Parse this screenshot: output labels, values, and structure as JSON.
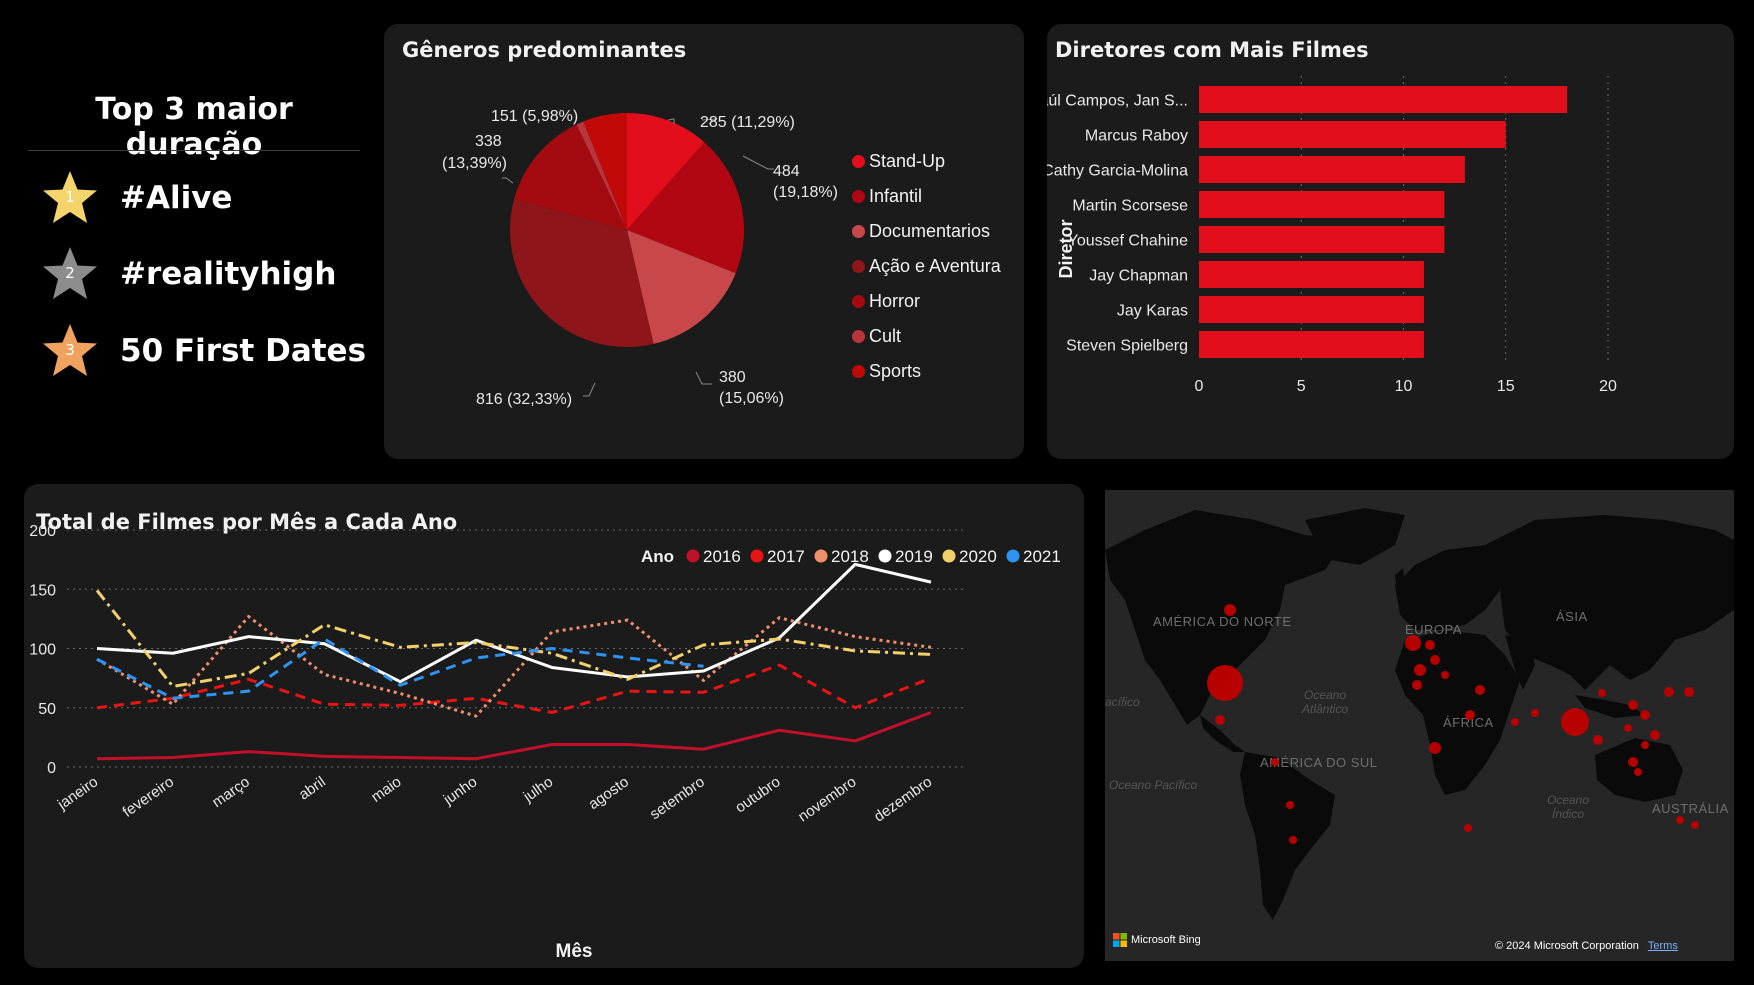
{
  "top3": {
    "title": "Top 3 maior duração",
    "items": [
      {
        "rank": "1",
        "name": "#Alive",
        "color": "#f5d56b"
      },
      {
        "rank": "2",
        "name": "#realityhigh",
        "color": "#8c8c8c"
      },
      {
        "rank": "3",
        "name": "50 First Dates",
        "color": "#f0a35e"
      }
    ]
  },
  "pie": {
    "title": "Gêneros predominantes",
    "slices": [
      {
        "name": "Stand-Up",
        "value": 285,
        "label": "285 (11,29%)",
        "color": "#e30e1b"
      },
      {
        "name": "Infantil",
        "value": 484,
        "label": "484 (19,18%)",
        "color": "#b00713"
      },
      {
        "name": "Documentarios",
        "value": 380,
        "label": "380 (15,06%)",
        "color": "#c8474b"
      },
      {
        "name": "Ação e Aventura",
        "value": 816,
        "label": "816 (32,33%)",
        "color": "#8e1519"
      },
      {
        "name": "Horror",
        "value": 338,
        "label": "338 (13,39%)",
        "color": "#a40b10"
      },
      {
        "name": "Cult",
        "value": 25,
        "label": "",
        "color": "#b8363b"
      },
      {
        "name": "Sports",
        "value": 151,
        "label": "151 (5,98%)",
        "color": "#c10909"
      }
    ],
    "label_parts": {
      "stand_up": "285 (11,29%)",
      "infantil_a": "484",
      "infantil_b": "(19,18%)",
      "doc_a": "380",
      "doc_b": "(15,06%)",
      "acao": "816 (32,33%)",
      "horror_a": "338",
      "horror_b": "(13,39%)",
      "sports": "151 (5,98%)"
    }
  },
  "directors": {
    "title": "Diretores com Mais Filmes",
    "axis_label": "Diretor",
    "ticks": [
      "0",
      "5",
      "10",
      "15",
      "20"
    ],
    "max": 20,
    "color": "#e30e1b",
    "rows": [
      {
        "name": "Raúl Campos, Jan S...",
        "value": 18
      },
      {
        "name": "Marcus Raboy",
        "value": 15
      },
      {
        "name": "Cathy Garcia-Molina",
        "value": 13
      },
      {
        "name": "Martin Scorsese",
        "value": 12
      },
      {
        "name": "Youssef Chahine",
        "value": 12
      },
      {
        "name": "Jay Chapman",
        "value": 11
      },
      {
        "name": "Jay Karas",
        "value": 11
      },
      {
        "name": "Steven Spielberg",
        "value": 11
      }
    ]
  },
  "chart_data": {
    "type": "line",
    "title": "Total de Filmes por Mês a Cada Ano",
    "xlabel": "Mês",
    "ylabel": "",
    "legend_title": "Ano",
    "ylim": [
      0,
      200
    ],
    "yticks": [
      "0",
      "50",
      "100",
      "150",
      "200"
    ],
    "categories": [
      "janeiro",
      "fevereiro",
      "março",
      "abril",
      "maio",
      "junho",
      "julho",
      "agosto",
      "setembro",
      "outubro",
      "novembro",
      "dezembro"
    ],
    "series": [
      {
        "name": "2016",
        "color": "#c0102a",
        "dash": "",
        "values": [
          7,
          8,
          13,
          9,
          8,
          7,
          19,
          19,
          15,
          31,
          22,
          46
        ]
      },
      {
        "name": "2017",
        "color": "#e81414",
        "dash": "10,7",
        "values": [
          50,
          58,
          74,
          53,
          52,
          58,
          46,
          64,
          63,
          86,
          50,
          75
        ]
      },
      {
        "name": "2018",
        "color": "#f0906a",
        "dash": "3,4",
        "values": [
          91,
          53,
          127,
          78,
          62,
          43,
          114,
          124,
          73,
          126,
          110,
          101
        ]
      },
      {
        "name": "2019",
        "color": "#ffffff",
        "dash": "",
        "values": [
          100,
          96,
          110,
          104,
          72,
          107,
          84,
          76,
          81,
          109,
          171,
          156
        ]
      },
      {
        "name": "2020",
        "color": "#f2d16b",
        "dash": "12,5,3,5",
        "values": [
          149,
          68,
          79,
          120,
          101,
          105,
          96,
          74,
          103,
          108,
          98,
          95
        ]
      },
      {
        "name": "2021",
        "color": "#2d94f4",
        "dash": "10,7",
        "values": [
          91,
          58,
          64,
          108,
          69,
          92,
          100,
          92,
          85,
          null,
          null,
          null
        ]
      }
    ]
  },
  "map": {
    "labels": {
      "north_america": "AMÉRICA DO NORTE",
      "europe": "EUROPA",
      "asia": "ÁSIA",
      "africa": "ÁFRICA",
      "south_america": "AMÉRICA DO SUL",
      "australia": "AUSTRÁLIA",
      "atlantic_a": "Oceano",
      "atlantic_b": "Atlântico",
      "pacific": "Oceano Pacífico",
      "pacific_left": "acífico",
      "indian_a": "Oceano",
      "indian_b": "Índico"
    },
    "bing": "Microsoft Bing",
    "copyright": "© 2024 Microsoft Corporation",
    "terms": "Terms",
    "marker_color": "#c00000"
  }
}
